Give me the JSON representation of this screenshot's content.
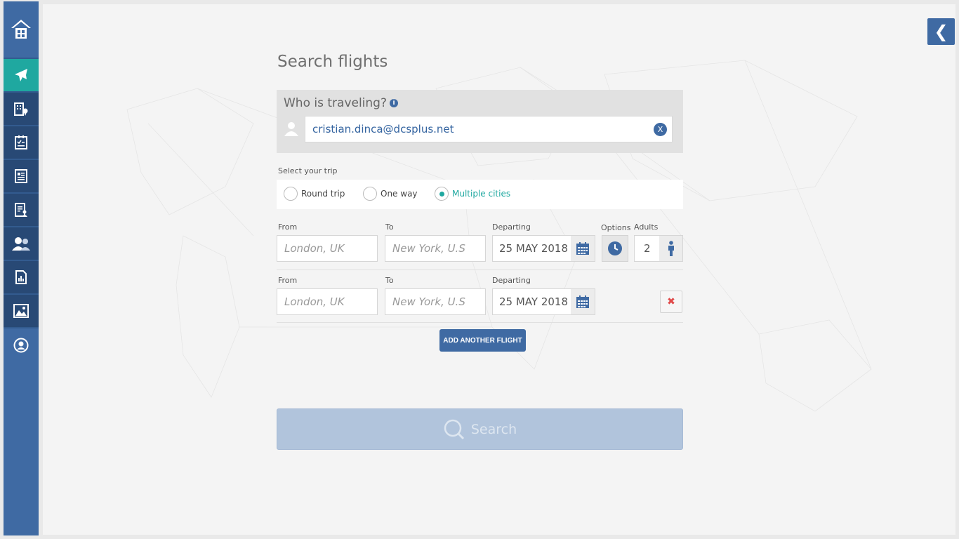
{
  "sidebar": {
    "items": [
      {
        "name": "home-icon"
      },
      {
        "name": "airplane-icon"
      },
      {
        "name": "hotel-icon"
      },
      {
        "name": "checklist-icon"
      },
      {
        "name": "document-list-icon"
      },
      {
        "name": "report-user-icon"
      },
      {
        "name": "users-icon"
      },
      {
        "name": "stats-icon"
      },
      {
        "name": "image-icon"
      },
      {
        "name": "profile-icon"
      }
    ],
    "active_index": 1,
    "colors": {
      "base": "#3f6aa3",
      "active": "#1fa8a0",
      "dark": "#284975"
    }
  },
  "collapse_button": {
    "icon": "chevron-left-icon",
    "label": "❮"
  },
  "page": {
    "title": "Search flights"
  },
  "traveler": {
    "label": "Who is traveling?",
    "value": "cristian.dinca@dcsplus.net",
    "clear_label": "X"
  },
  "trip": {
    "label": "Select your trip",
    "options": [
      "Round trip",
      "One way",
      "Multiple cities"
    ],
    "selected": "Multiple cities"
  },
  "flights": {
    "labels": {
      "from": "From",
      "to": "To",
      "departing": "Departing",
      "options": "Options",
      "adults": "Adults"
    },
    "rows": [
      {
        "from_placeholder": "London, UK",
        "to_placeholder": "New York, U.S",
        "date": "25 MAY 2018",
        "adults": "2"
      },
      {
        "from_placeholder": "London, UK",
        "to_placeholder": "New York, U.S",
        "date": "25 MAY 2018",
        "remove_label": "✖"
      }
    ]
  },
  "add_flight_label": "ADD ANOTHER FLIGHT",
  "search_label": "Search"
}
